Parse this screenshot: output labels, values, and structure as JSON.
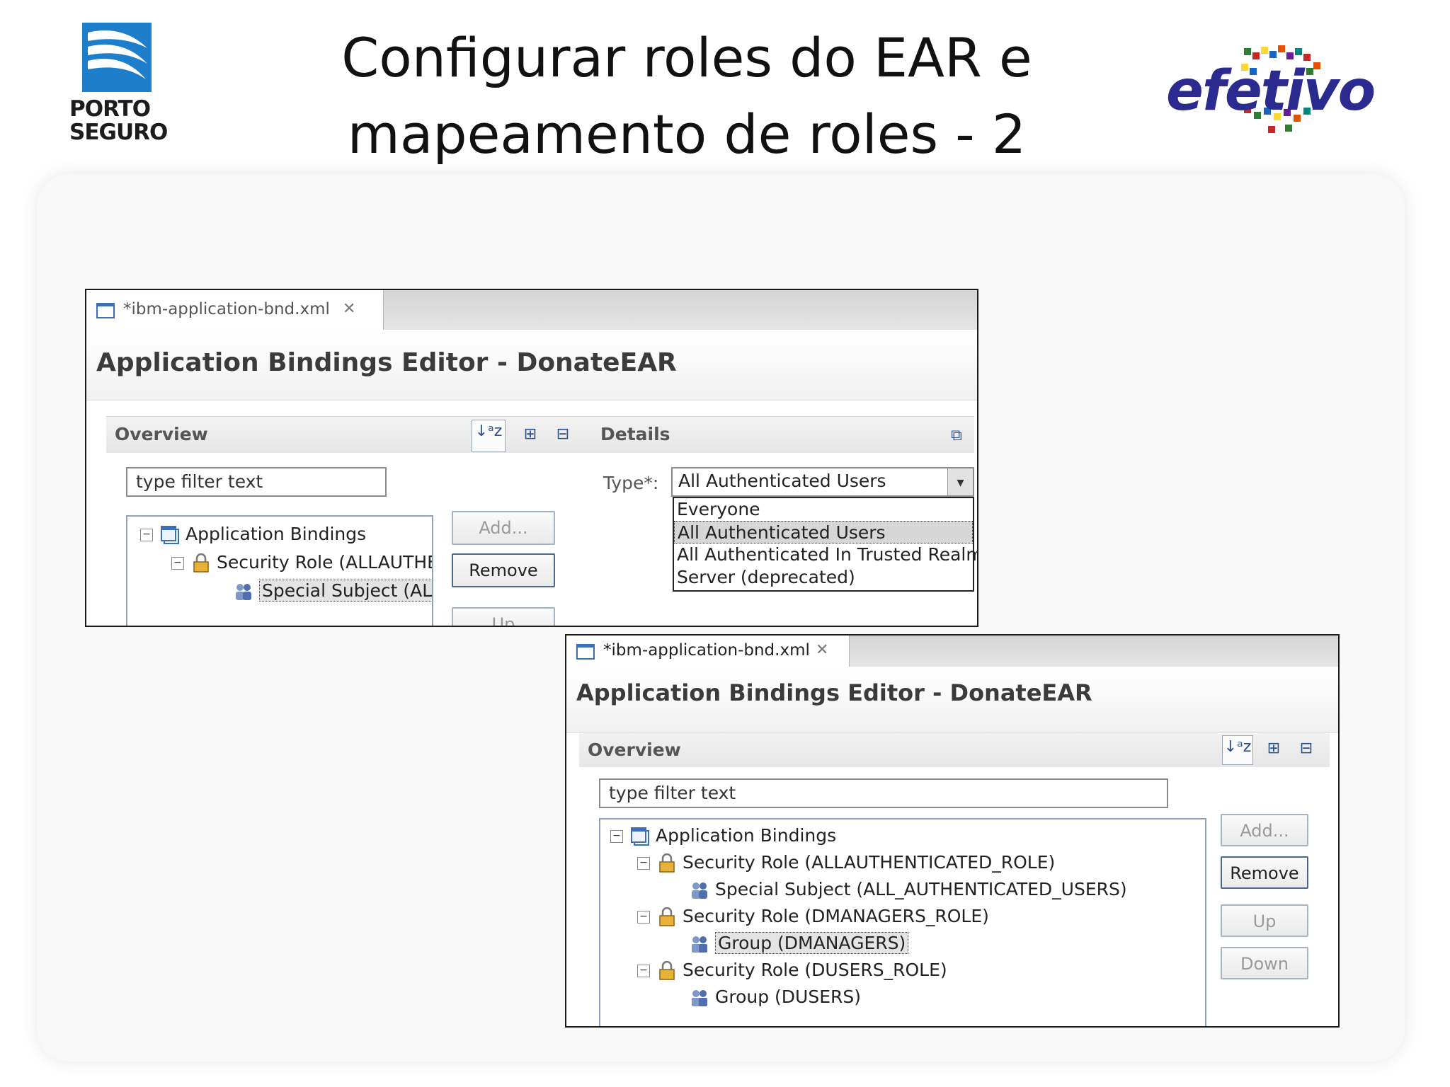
{
  "slide": {
    "title_line1": "Configurar roles do EAR e",
    "title_line2": "mapeamento de roles - 2",
    "logo_left_line1": "PORTO",
    "logo_left_line2": "SEGURO",
    "logo_right_text": "efetivo",
    "colors": {
      "porto_blue": "#1d7fcb",
      "efetivo_navy": "#2a2a8f"
    }
  },
  "screen1": {
    "tab_label": "*ibm-application-bnd.xml",
    "tab_close_icon": "close-icon",
    "editor_title": "Application Bindings Editor - DonateEAR",
    "overview": {
      "label": "Overview",
      "toolbar": [
        "sort-az-icon",
        "expand-all-icon",
        "collapse-all-icon"
      ],
      "filter_placeholder": "type filter text",
      "tree": [
        {
          "label": "Application Bindings",
          "icon": "app-bindings-icon"
        },
        {
          "label": "Security Role (ALLAUTHE",
          "icon": "security-role-icon"
        },
        {
          "label": "Special Subject (ALL_",
          "icon": "special-subject-icon"
        }
      ],
      "buttons": {
        "add": "Add...",
        "remove": "Remove",
        "up": "Up"
      }
    },
    "details": {
      "label": "Details",
      "type_label": "Type*:",
      "type_value": "All Authenticated Users",
      "options": [
        "Everyone",
        "All Authenticated Users",
        "All Authenticated In Trusted Realms",
        "Server (deprecated)"
      ],
      "highlighted_option": "All Authenticated Users"
    }
  },
  "screen2": {
    "tab_label": "*ibm-application-bnd.xml",
    "tab_close_icon": "close-icon",
    "editor_title": "Application Bindings Editor - DonateEAR",
    "overview": {
      "label": "Overview",
      "toolbar": [
        "sort-az-icon",
        "expand-all-icon",
        "collapse-all-icon"
      ],
      "filter_placeholder": "type filter text",
      "tree": [
        {
          "label": "Application Bindings",
          "icon": "app-bindings-icon"
        },
        {
          "label": "Security Role (ALLAUTHENTICATED_ROLE)",
          "icon": "security-role-icon"
        },
        {
          "label": "Special Subject (ALL_AUTHENTICATED_USERS)",
          "icon": "special-subject-icon"
        },
        {
          "label": "Security Role (DMANAGERS_ROLE)",
          "icon": "security-role-icon"
        },
        {
          "label": "Group (DMANAGERS)",
          "icon": "group-icon",
          "selected": true
        },
        {
          "label": "Security Role (DUSERS_ROLE)",
          "icon": "security-role-icon"
        },
        {
          "label": "Group (DUSERS)",
          "icon": "group-icon"
        }
      ],
      "buttons": {
        "add": "Add...",
        "remove": "Remove",
        "up": "Up",
        "down": "Down"
      }
    }
  }
}
